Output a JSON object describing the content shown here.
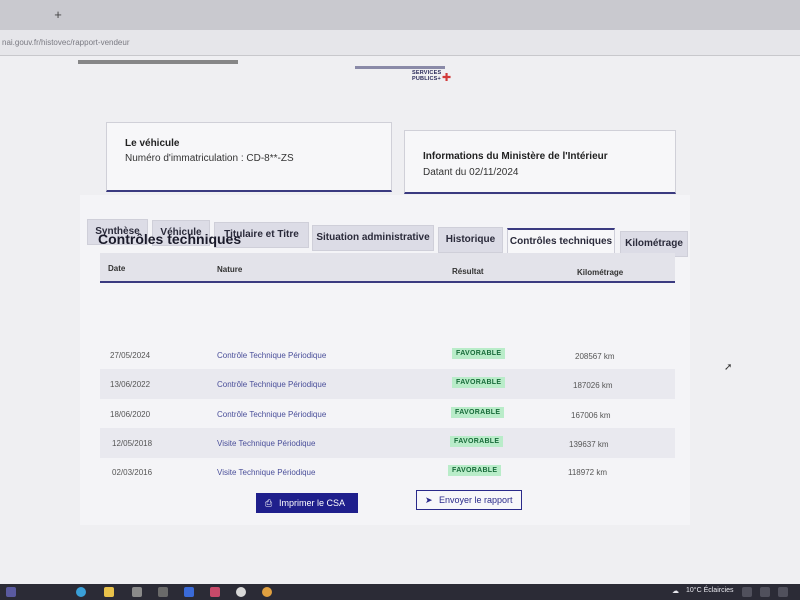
{
  "browser": {
    "new_tab_label": "+",
    "url": "nai.gouv.fr/histovec/rapport-vendeur"
  },
  "header": {
    "logo_line1": "SERVICES",
    "logo_line2": "PUBLICS+",
    "logo_mark": "✚"
  },
  "vehicle_card": {
    "title": "Le véhicule",
    "plate_text": "Numéro d'immatriculation : CD-8**-ZS"
  },
  "ministry_card": {
    "title": "Informations du Ministère de l'Intérieur",
    "date_text": "Datant du 02/11/2024"
  },
  "tabs": [
    {
      "label": "Synthèse"
    },
    {
      "label": "Véhicule"
    },
    {
      "label": "Titulaire et Titre"
    },
    {
      "label": "Situation administrative"
    },
    {
      "label": "Historique"
    },
    {
      "label": "Contrôles techniques",
      "active": true
    },
    {
      "label": "Kilométrage"
    }
  ],
  "section": {
    "title": "Contrôles techniques"
  },
  "table": {
    "headers": {
      "date": "Date",
      "nature": "Nature",
      "result": "Résultat",
      "km": "Kilométrage"
    },
    "rows": [
      {
        "date": "27/05/2024",
        "nature": "Contrôle Technique Périodique",
        "result": "FAVORABLE",
        "km": "208567 km"
      },
      {
        "date": "13/06/2022",
        "nature": "Contrôle Technique Périodique",
        "result": "FAVORABLE",
        "km": "187026 km"
      },
      {
        "date": "18/06/2020",
        "nature": "Contrôle Technique Périodique",
        "result": "FAVORABLE",
        "km": "167006 km"
      },
      {
        "date": "12/05/2018",
        "nature": "Visite Technique Périodique",
        "result": "FAVORABLE",
        "km": "139637 km"
      },
      {
        "date": "02/03/2016",
        "nature": "Visite Technique Périodique",
        "result": "FAVORABLE",
        "km": "118972 km"
      }
    ]
  },
  "actions": {
    "print_label": "Imprimer le CSA",
    "print_icon": "print-icon",
    "send_label": "Envoyer le rapport",
    "send_icon": "send-icon"
  },
  "taskbar": {
    "weather": "10°C  Éclaircies"
  },
  "colors": {
    "accent": "#1f1f8c",
    "badge_bg": "#b9ecc9",
    "badge_text": "#186b3a"
  }
}
